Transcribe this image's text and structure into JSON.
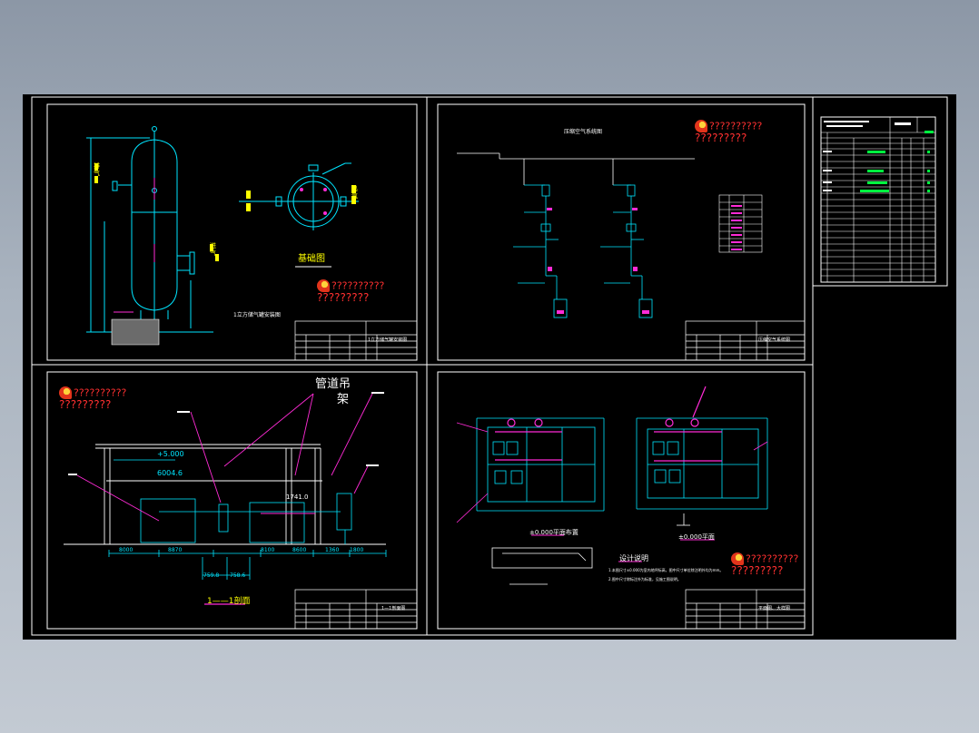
{
  "colors": {
    "background_top": "#8c97a6",
    "sheet": "#000000",
    "frame": "#ffffff",
    "cyan": "#00e5ff",
    "magenta": "#ff2bd6",
    "green": "#00ff40",
    "yellow": "#ffff00",
    "red": "#ff3030"
  },
  "panels": {
    "tl": {
      "caption": "1立方储气罐安装图",
      "label_top": "基础图",
      "side_a": "排气",
      "side_b": "进气",
      "side_c": "出气"
    },
    "tr": {
      "caption": "压缩空气系统图"
    },
    "bl": {
      "title_a": "管道吊",
      "title_b": "架",
      "section": "1——1剖面",
      "dim_1": "+5.000",
      "dim_2": "6004.6",
      "dim_3": "1741.0",
      "dims_bottom": [
        "8000",
        "8870",
        "8100",
        "8600",
        "1360",
        "1800"
      ],
      "dim_small_1": "759.8",
      "dim_small_2": "758.6"
    },
    "br": {
      "plan_1": "±0.000平面布置",
      "plan_2": "±0.000平面",
      "notes_title": "设计说明",
      "note_1": "1.本图尺寸±0.000为室内地坪标高，图中尺寸单位除注明外均为mm。",
      "note_2": "2.图中尺寸除标注外为标准，见施工图说明。"
    }
  },
  "watermark": {
    "line1": "??????????",
    "line2": "?????????"
  },
  "title_blocks": {
    "tl": "1立方储气罐安装图",
    "tr": "压缩空气系统图",
    "bl": "1—1剖面图",
    "br": "平面图、大样图"
  }
}
